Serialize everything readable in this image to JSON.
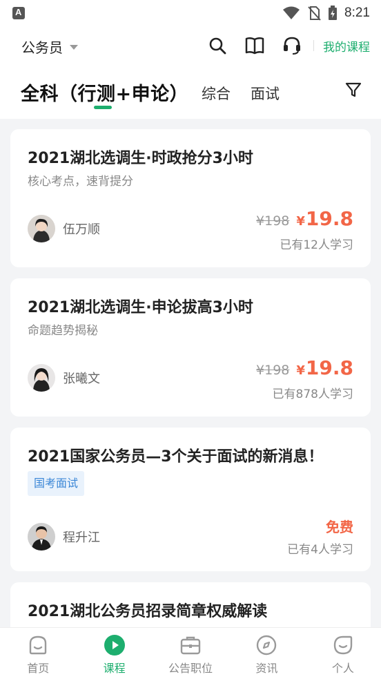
{
  "status_bar": {
    "time": "8:21"
  },
  "header": {
    "location": "公务员",
    "my_course_label": "我的课程",
    "accent_color": "#1dae6e"
  },
  "tabs": {
    "active": "全科（行测+申论）",
    "others": [
      "综合",
      "面试"
    ]
  },
  "courses": [
    {
      "title": "2021湖北选调生·时政抢分3小时",
      "subtitle": "核心考点，速背提分",
      "teacher": "伍万顺",
      "original_price": "¥198",
      "price_symbol": "¥",
      "price": "19.8",
      "learners": "已有12人学习"
    },
    {
      "title": "2021湖北选调生·申论拔高3小时",
      "subtitle": "命题趋势揭秘",
      "teacher": "张曦文",
      "original_price": "¥198",
      "price_symbol": "¥",
      "price": "19.8",
      "learners": "已有878人学习"
    },
    {
      "title": "2021国家公务员—3个关于面试的新消息！",
      "tag": "国考面试",
      "teacher": "程升江",
      "free_label": "免费",
      "learners": "已有4人学习"
    },
    {
      "title": "2021湖北公务员招录简章权威解读"
    }
  ],
  "bottom_nav": [
    {
      "label": "首页",
      "icon": "home-face-icon"
    },
    {
      "label": "课程",
      "icon": "play-circle-icon"
    },
    {
      "label": "公告职位",
      "icon": "briefcase-icon"
    },
    {
      "label": "资讯",
      "icon": "compass-icon"
    },
    {
      "label": "个人",
      "icon": "profile-face-icon"
    }
  ]
}
